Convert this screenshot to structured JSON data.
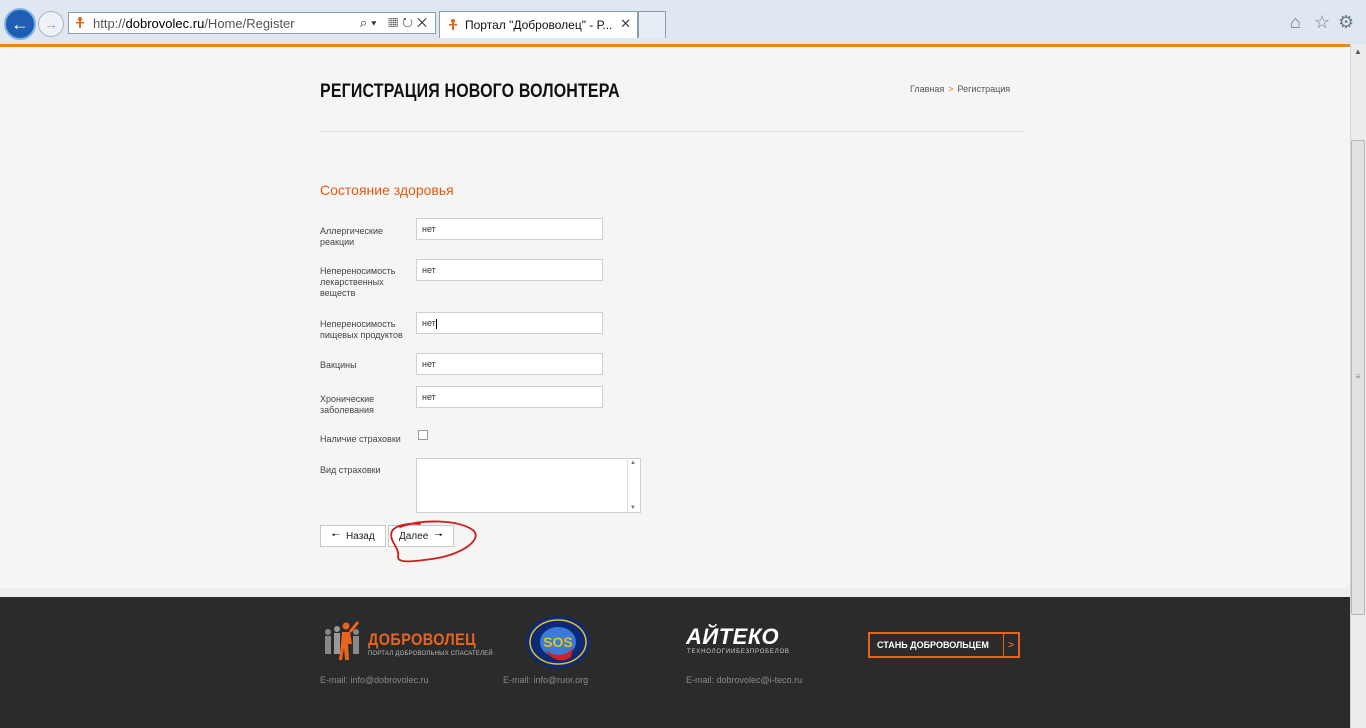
{
  "browser": {
    "url_prefix": "http://",
    "url_domain": "dobrovolec.ru",
    "url_path": "/Home/Register",
    "address_tools": "⌕▾ ▦↻✕",
    "tab_title": "Портал \"Доброволец\" - Р...",
    "tab_close": "✕"
  },
  "header": {
    "title": "РЕГИСТРАЦИЯ НОВОГО ВОЛОНТЕРА",
    "breadcrumb_home": "Главная",
    "breadcrumb_sep": ">",
    "breadcrumb_current": "Регистрация"
  },
  "form": {
    "section_title": "Состояние здоровья",
    "fields": [
      {
        "label": "Аллергические реакции",
        "value": "нет"
      },
      {
        "label": "Непереносимость лекарственных веществ",
        "value": "нет"
      },
      {
        "label": "Непереносимость пищевых продуктов",
        "value": "нет"
      },
      {
        "label": "Вакцины",
        "value": "нет"
      },
      {
        "label": "Хронические заболевания",
        "value": "нет"
      }
    ],
    "insurance_label": "Наличие страховки",
    "insurance_checked": false,
    "insurance_type_label": "Вид страховки",
    "insurance_type_value": "",
    "back_label": "Назад",
    "next_label": "Далее"
  },
  "footer": {
    "brand_name": "ДОБРОВОЛЕЦ",
    "brand_tagline": "ПОРТАЛ ДОБРОВОЛЬНЫХ СПАСАТЕЛЕЙ",
    "partner_name": "АЙТЕКО",
    "partner_tagline": "ТЕХНОЛОГИИБЕЗПРОБЕЛОВ",
    "email_1": "E-mail: info@dobrovolec.ru",
    "email_2": "E-mail: info@ruor.org",
    "email_3": "E-mail: dobrovolec@i-teco.ru",
    "cta_label": "СТАНЬ ДОБРОВОЛЬЦЕМ",
    "cta_chevron": ">"
  },
  "colors": {
    "accent": "#e8641e",
    "section_title": "#e05a14",
    "footer_bg": "#2b2b2b",
    "annotation": "#d11a1a"
  },
  "icons": {
    "back": "arrow-left-icon",
    "forward": "arrow-right-icon",
    "home": "home-icon",
    "favorites": "star-icon",
    "settings": "gear-icon"
  }
}
